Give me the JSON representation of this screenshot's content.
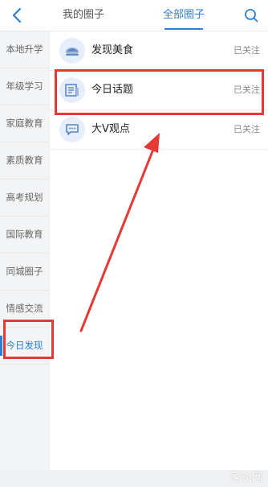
{
  "header": {
    "back_icon": "chevron-left-icon",
    "tab_mine": "我的圈子",
    "tab_all": "全部圈子",
    "search_icon": "search-icon",
    "accent_color": "#2d7fd3"
  },
  "sidebar": {
    "items": [
      {
        "label": "本地升学"
      },
      {
        "label": "年级学习"
      },
      {
        "label": "家庭教育"
      },
      {
        "label": "素质教育"
      },
      {
        "label": "高考规划"
      },
      {
        "label": "国际教育"
      },
      {
        "label": "同城圈子"
      },
      {
        "label": "情感交流"
      },
      {
        "label": "今日发现",
        "active": true
      }
    ]
  },
  "circles": [
    {
      "name": "发现美食",
      "status": "已关注",
      "icon": "food-icon"
    },
    {
      "name": "今日话题",
      "status": "已关注",
      "icon": "news-icon"
    },
    {
      "name": "大V观点",
      "status": "已关注",
      "icon": "chat-bubble-icon"
    }
  ],
  "annotation": {
    "color": "#e53935"
  },
  "watermark": {
    "text": "家长网"
  }
}
